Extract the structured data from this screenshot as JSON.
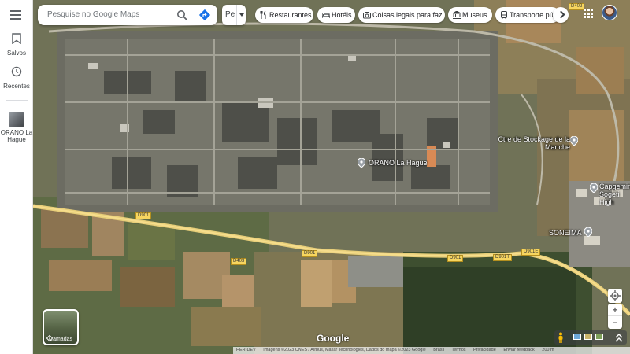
{
  "search": {
    "placeholder": "Pesquise no Google Maps"
  },
  "tab_cut": {
    "label": "Pe"
  },
  "rail": {
    "saved_label": "Salvos",
    "recent_label": "Recentes",
    "recent_place": "ORANO La Hague"
  },
  "chips": [
    {
      "label": "Restaurantes",
      "icon": "restaurant-icon"
    },
    {
      "label": "Hotéis",
      "icon": "hotel-icon"
    },
    {
      "label": "Coisas legais para faz...",
      "icon": "camera-icon"
    },
    {
      "label": "Museus",
      "icon": "museum-icon"
    },
    {
      "label": "Transporte púb",
      "icon": "transit-icon"
    }
  ],
  "map": {
    "places": [
      {
        "label": "ORANO La Hague"
      },
      {
        "label": "Ctre de Stockage de la Manche"
      },
      {
        "label": "Capgemini Sogeti High"
      },
      {
        "label": "SONEIMA"
      }
    ],
    "roads": [
      "D901",
      "D403",
      "D901",
      "D901",
      "D901T",
      "D901E",
      "D402"
    ],
    "layers_label": "Camadas",
    "google_logo": "Google",
    "attribution": {
      "text": "Imagens ©2023 CNES / Airbus, Maxar Technologies, Dados do mapa ©2023 Google",
      "country": "Brasil",
      "terms": "Termos",
      "privacy": "Privacidade",
      "feedback": "Enviar feedback",
      "scale": "200 m"
    },
    "top_left_label": "HER-DEV"
  },
  "colors": {
    "accent": "#1a73e8",
    "road": "#f6d55f"
  }
}
